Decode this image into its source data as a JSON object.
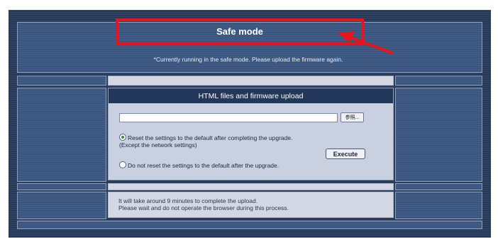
{
  "safe_mode": {
    "title": "Safe mode",
    "note": "*Currently running in the safe mode. Please upload the firmware again."
  },
  "upload": {
    "header": "HTML files and firmware upload",
    "file_value": "",
    "browse_label": "参照...",
    "option_reset": "Reset the settings to the default after completing the upgrade.",
    "option_reset_note": "(Except the network settings)",
    "option_no_reset": "Do not reset the settings to the default after the upgrade.",
    "selected_option": "reset",
    "execute_label": "Execute"
  },
  "notice": {
    "line1": "It will take around 9 minutes to complete the upload.",
    "line2": "Please wait and do not operate the browser during this process."
  },
  "colors": {
    "highlight_box": "#e8141b",
    "frame": "#283a5a",
    "panel_header": "#22375a"
  },
  "icons": {
    "annotation": "red-arrow-icon"
  }
}
